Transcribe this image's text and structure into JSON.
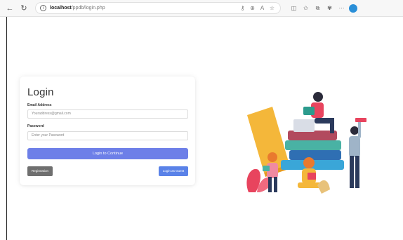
{
  "browser": {
    "url_host": "localhost",
    "url_path": "/ppdb/login.php"
  },
  "login": {
    "title": "Login",
    "email_label": "Email Address",
    "email_placeholder": "Youraddress@gmail.com",
    "password_label": "Password",
    "password_placeholder": "Enter your Password",
    "submit_label": "Login to Continue",
    "register_label": "Registration",
    "guest_label": "Login as Guest"
  },
  "colors": {
    "primary": "#6d7fe8",
    "guest": "#5a82e8",
    "register": "#6f6f6f"
  }
}
